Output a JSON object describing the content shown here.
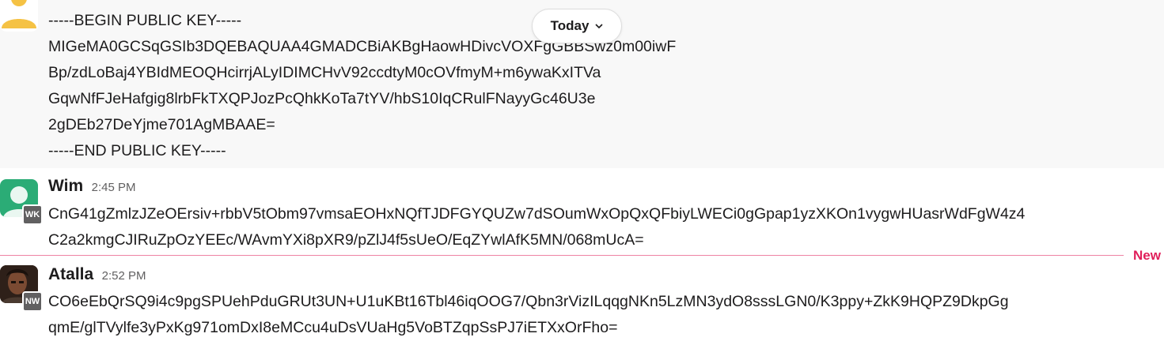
{
  "top_message": {
    "lines": [
      "-----BEGIN PUBLIC KEY-----",
      "MIGeMA0GCSqGSIb3DQEBAQUAA4GMADCBiAKBgHaowHDivcVOXFgGBBSwz0m00iwF",
      "Bp/zdLoBaj4YBIdMEOQHcirrjALyIDIMCHvV92ccdtyM0cOVfmyM+m6ywaKxITVa",
      "GqwNfFJeHafgig8lrbFkTXQPJozPcQhkKoTa7tYV/hbS10IqCRulFNayyGc46U3e",
      "2gDEb27DeYjme701AgMBAAE=",
      "-----END PUBLIC KEY-----"
    ]
  },
  "date_divider": {
    "label": "Today",
    "icon": "chevron-down-icon"
  },
  "messages": [
    {
      "sender": "Wim",
      "time": "2:45 PM",
      "badge": "WK",
      "lines": [
        "CnG41gZmlzJZeOErsiv+rbbV5tObm97vmsaEOHxNQfTJDFGYQUZw7dSOumWxOpQxQFbiyLWECi0gGpap1yzXKOn1vygwHUasrWdFgW4z4",
        "C2a2kmgCJIRuZpOzYEEc/WAvmYXi8pXR9/pZlJ4f5sUeO/EqZYwlAfK5MN/068mUcA="
      ]
    },
    {
      "sender": "Atalla",
      "time": "2:52 PM",
      "badge": "NW",
      "lines": [
        "CO6eEbQrSQ9i4c9pgSPUehPduGRUt3UN+U1uKBt16Tbl46iqOOG7/Qbn3rVizILqqgNKn5LzMN3ydO8sssLGN0/K3ppy+ZkK9HQPZ9DkpGg",
        "qmE/glTVylfe3yPxKg971omDxI8eMCcu4uDsVUaHg5VoBTZqpSsPJ7iETXxOrFho="
      ]
    }
  ],
  "new_divider": {
    "label": "New"
  },
  "colors": {
    "new_accent": "#e01e5a",
    "avatar_green": "#2bac76",
    "avatar_yellow": "#f5c244",
    "badge_gray": "#616061"
  }
}
